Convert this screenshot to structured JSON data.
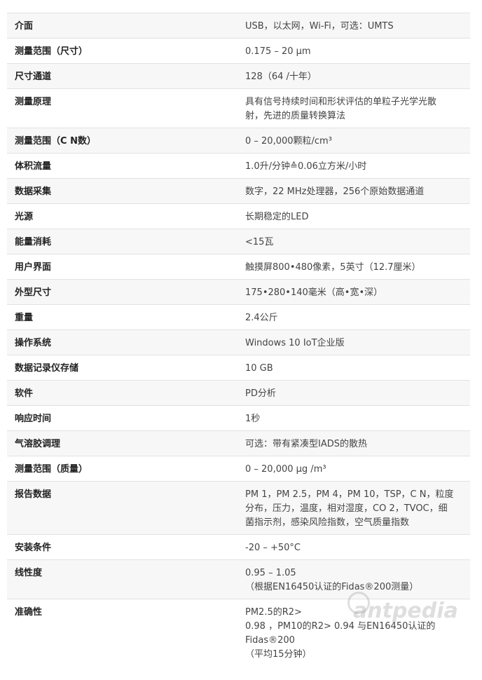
{
  "watermark": "antpedia",
  "rows": [
    {
      "label": "介面",
      "lines": [
        "USB，以太网，Wi-Fi，可选：UMTS"
      ]
    },
    {
      "label": "测量范围（尺寸）",
      "lines": [
        "0.175 – 20 µm"
      ]
    },
    {
      "label": "尺寸通道",
      "lines": [
        "128（64 /十年）"
      ]
    },
    {
      "label": "测量原理",
      "lines": [
        "具有信号持续时间和形状评估的单粒子光学光散",
        "射，先进的质量转换算法"
      ]
    },
    {
      "label": "测量范围（C N数）",
      "lines": [
        "0 – 20,000颗粒/cm³"
      ]
    },
    {
      "label": "体积流量",
      "lines": [
        "1.0升/分钟≙0.06立方米/小时"
      ]
    },
    {
      "label": "数据采集",
      "lines": [
        "数字，22 MHz处理器，256个原始数据通道"
      ]
    },
    {
      "label": "光源",
      "lines": [
        "长期稳定的LED"
      ]
    },
    {
      "label": "能量消耗",
      "lines": [
        "<15瓦"
      ]
    },
    {
      "label": "用户界面",
      "lines": [
        "触摸屏800•480像素，5英寸（12.7厘米）"
      ]
    },
    {
      "label": "外型尺寸",
      "lines": [
        "175•280•140毫米（高•宽•深）"
      ]
    },
    {
      "label": "重量",
      "lines": [
        "2.4公斤"
      ]
    },
    {
      "label": "操作系统",
      "lines": [
        "Windows 10 IoT企业版"
      ]
    },
    {
      "label": "数据记录仪存储",
      "lines": [
        "10 GB"
      ]
    },
    {
      "label": "软件",
      "lines": [
        "PD分析"
      ]
    },
    {
      "label": "响应时间",
      "lines": [
        "1秒"
      ]
    },
    {
      "label": "气溶胶调理",
      "lines": [
        "可选：带有紧凑型IADS的散热"
      ]
    },
    {
      "label": "测量范围（质量）",
      "lines": [
        "0 – 20,000 µg /m³"
      ]
    },
    {
      "label": "报告数据",
      "lines": [
        "PM 1，PM 2.5，PM 4，PM 10，TSP，C N，粒度",
        "分布，压力，温度，相对湿度，CO 2，TVOC，细",
        "菌指示剂，感染风险指数，空气质量指数"
      ]
    },
    {
      "label": "安装条件",
      "lines": [
        "-20 – +50°C"
      ]
    },
    {
      "label": "线性度",
      "lines": [
        "0.95 – 1.05",
        "（根据EN16450认证的Fidas®200测量）"
      ]
    },
    {
      "label": "准确性",
      "lines": [
        "PM2.5的R2>",
        "0.98 ，PM10的R2> 0.94 与EN16450认证的",
        "Fidas®200",
        "（平均15分钟）"
      ]
    }
  ]
}
